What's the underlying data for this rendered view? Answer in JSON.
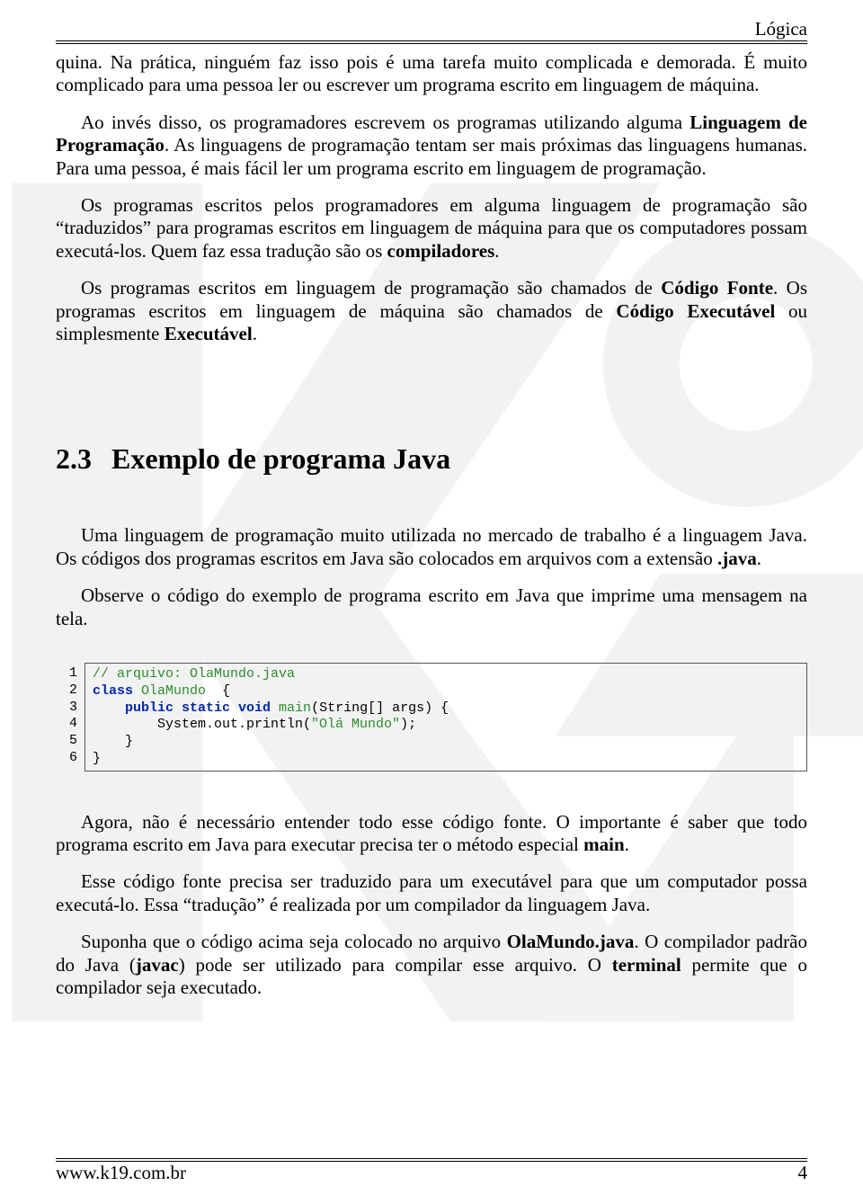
{
  "header": {
    "label": "Lógica"
  },
  "paragraphs": {
    "p1": "quina. Na prática, ninguém faz isso pois é uma tarefa muito complicada e demorada. É muito complicado para uma pessoa ler ou escrever um programa escrito em linguagem de máquina.",
    "p2_a": "Ao invés disso, os programadores escrevem os programas utilizando alguma ",
    "p2_b": "Linguagem de Programação",
    "p2_c": ". As linguagens de programação tentam ser mais próximas das linguagens humanas. Para uma pessoa, é mais fácil ler um programa escrito em linguagem de programação.",
    "p3_a": "Os programas escritos pelos programadores em alguma linguagem de programação são “traduzidos” para programas escritos em linguagem de máquina para que os computadores possam executá-los. Quem faz essa tradução são os ",
    "p3_b": "compiladores",
    "p3_c": ".",
    "p4_a": "Os programas escritos em linguagem de programação são chamados de ",
    "p4_b": "Código Fonte",
    "p4_c": ". Os programas escritos em linguagem de máquina são chamados de ",
    "p4_d": "Código Executável",
    "p4_e": " ou simplesmente ",
    "p4_f": "Executável",
    "p4_g": "."
  },
  "section": {
    "number": "2.3",
    "title": "Exemplo de programa Java"
  },
  "paragraphs2": {
    "p5_a": "Uma linguagem de programação muito utilizada no mercado de trabalho é a linguagem Java. Os códigos dos programas escritos em Java são colocados em arquivos com a extensão ",
    "p5_b": ".java",
    "p5_c": ".",
    "p6": "Observe o código do exemplo de programa escrito em Java que imprime uma mensagem na tela."
  },
  "code": {
    "lines": [
      "1",
      "2",
      "3",
      "4",
      "5",
      "6"
    ],
    "l1_comment": "// arquivo: OlaMundo.java",
    "l2_kw": "class",
    "l2_type": " OlaMundo  ",
    "l2_plain": "{",
    "l3_indent": "    ",
    "l3_kw": "public static void",
    "l3_method": " main",
    "l3_plain_a": "(String[] args) {",
    "l4_indent": "        ",
    "l4_plain_a": "System.out.println(",
    "l4_string": "\"Olá Mundo\"",
    "l4_plain_b": ");",
    "l5_indent": "    ",
    "l5_plain": "}",
    "l6_plain": "}"
  },
  "paragraphs3": {
    "p7_a": "Agora, não é necessário entender todo esse código fonte. O importante é saber que todo programa escrito em Java para executar precisa ter o método especial ",
    "p7_b": "main",
    "p7_c": ".",
    "p8": "Esse código fonte precisa ser traduzido para um executável para que um computador possa executá-lo. Essa “tradução” é realizada por um compilador da linguagem Java.",
    "p9_a": "Suponha que o código acima seja colocado no arquivo ",
    "p9_b": "OlaMundo.java",
    "p9_c": ". O compilador padrão do Java (",
    "p9_d": "javac",
    "p9_e": ") pode ser utilizado para compilar esse arquivo. O ",
    "p9_f": "terminal",
    "p9_g": " permite que o compilador seja executado."
  },
  "footer": {
    "site": "www.k19.com.br",
    "page": "4"
  }
}
